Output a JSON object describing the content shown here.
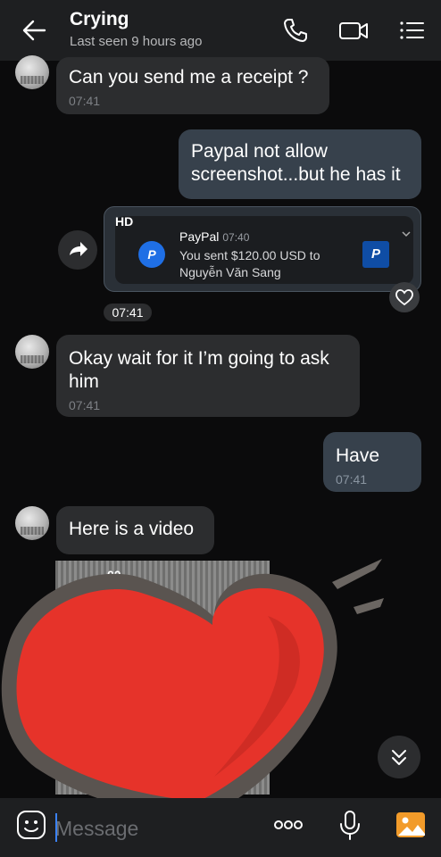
{
  "header": {
    "title": "Crying",
    "status": "Last seen 9 hours ago",
    "icons": [
      "back-arrow-icon",
      "phone-icon",
      "video-call-icon",
      "menu-list-icon"
    ]
  },
  "messages": [
    {
      "side": "in",
      "text": "Can you send me a receipt ?",
      "time": "07:41"
    },
    {
      "side": "out",
      "text": "Paypal not allow screenshot...but he has it"
    },
    {
      "side": "out",
      "type": "image",
      "time": "07:41"
    },
    {
      "side": "in",
      "text": "Okay wait for it I’m going to ask him",
      "time": "07:41"
    },
    {
      "side": "out",
      "text": "Have",
      "time": "07:41"
    },
    {
      "side": "in",
      "text": "Here is a video"
    }
  ],
  "paypal_card": {
    "badge": "HD",
    "app": "PayPal",
    "time": "07:40",
    "line1": "You sent $120.00 USD to",
    "line2": "Nguyễn Văn Sang",
    "logo_letter": "P"
  },
  "video": {
    "counter": "00"
  },
  "input": {
    "placeholder": "Message"
  },
  "colors": {
    "accent": "#3b82f6",
    "heart": "#e6332a",
    "gallery": "#f29b2a"
  }
}
